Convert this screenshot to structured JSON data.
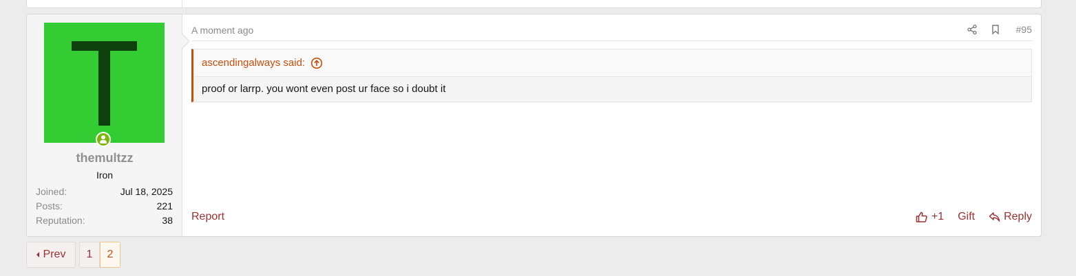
{
  "post": {
    "user": {
      "avatar_letter": "T",
      "avatar_bg": "#33cc33",
      "avatar_fg": "#0d400d",
      "online_icon": "user-online-icon",
      "username": "themultzz",
      "title": "Iron",
      "stats": [
        {
          "label": "Joined:",
          "value": "Jul 18, 2025"
        },
        {
          "label": "Posts:",
          "value": "221"
        },
        {
          "label": "Reputation:",
          "value": "38"
        }
      ]
    },
    "timestamp": "A moment ago",
    "header_icons": [
      "share-icon",
      "bookmark-icon"
    ],
    "post_number": "#95",
    "quote": {
      "attribution": "ascendingalways said:",
      "jump_icon": "circle-arrow-up-icon",
      "text": "proof or larrp. you wont even post ur face so i doubt it"
    },
    "footer": {
      "report_label": "Report",
      "like_icon": "thumbs-up-icon",
      "like_label": "+1",
      "gift_label": "Gift",
      "reply_icon": "reply-arrow-icon",
      "reply_label": "Reply"
    }
  },
  "pagination": {
    "prev_label": "Prev",
    "pages": [
      "1",
      "2"
    ],
    "current_page": "2"
  },
  "colors": {
    "accent": "#c84c0c",
    "link": "#9c3030",
    "online": "#7ab800"
  }
}
